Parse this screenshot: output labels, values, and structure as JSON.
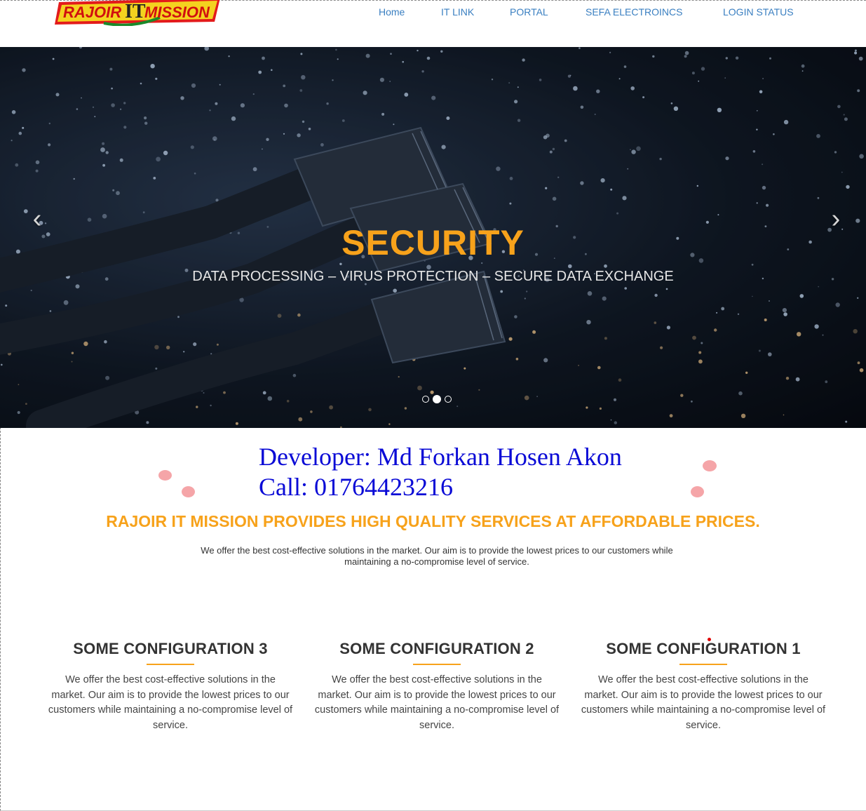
{
  "header": {
    "logo_text_left": "RAJOIR",
    "logo_text_mid": "IT",
    "logo_text_right": "MISSION",
    "nav": [
      {
        "label": "Home"
      },
      {
        "label": "IT LINK"
      },
      {
        "label": "PORTAL"
      },
      {
        "label": "SEFA ELECTROINCS"
      },
      {
        "label": "LOGIN STATUS"
      }
    ]
  },
  "carousel": {
    "title": "SECURITY",
    "subtitle": "DATA PROCESSING – VIRUS PROTECTION – SECURE DATA EXCHANGE",
    "prev_icon": "chevron-left-icon",
    "next_icon": "chevron-right-icon",
    "slide_count": 3,
    "active_slide": 2
  },
  "developer": {
    "name_line": "Developer: Md Forkan Hosen Akon",
    "call_line": "Call: 01764423216"
  },
  "tagline": "RAJOIR IT MISSION PROVIDES HIGH QUALITY SERVICES AT AFFORDABLE PRICES.",
  "intro": "We offer the best cost-effective solutions in the market. Our aim is to provide the lowest prices to our customers while maintaining a no-compromise level of service.",
  "configs": [
    {
      "title": "SOME CONFIGURATION 3",
      "text": "We offer the best cost-effective solutions in the market. Our aim is to provide the lowest prices to our customers while maintaining a no-compromise level of service."
    },
    {
      "title": "SOME CONFIGURATION 2",
      "text": "We offer the best cost-effective solutions in the market. Our aim is to provide the lowest prices to our customers while maintaining a no-compromise level of service."
    },
    {
      "title": "SOME CONFIGURATION 1",
      "text": "We offer the best cost-effective solutions in the market. Our aim is to provide the lowest prices to our customers while maintaining a no-compromise level of service."
    }
  ],
  "colors": {
    "accent": "#f7a21b",
    "nav_link": "#3a7fc1",
    "developer_text": "#0a0ad6"
  }
}
